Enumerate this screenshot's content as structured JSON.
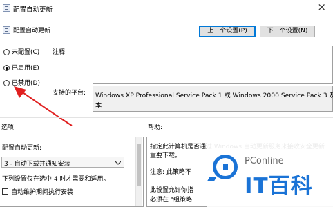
{
  "window": {
    "title": "配置自动更新",
    "close_glyph": "×",
    "setting_name": "配置自动更新",
    "prev_button": "上一个设置(P)",
    "next_button": "下一个设置(N)"
  },
  "state": {
    "options": [
      {
        "label": "未配置(C)",
        "selected": false
      },
      {
        "label": "已启用(E)",
        "selected": true
      },
      {
        "label": "已禁用(D)",
        "selected": false
      }
    ]
  },
  "comment": {
    "label": "注释:",
    "value": ""
  },
  "supported": {
    "label": "支持的平台:",
    "line1": "Windows XP Professional Service Pack 1 或 Windows 2000 Service Pack 3 及",
    "line2": "本"
  },
  "options_panel": {
    "label": "选项:",
    "configure_label": "配置自动更新:",
    "configure_value": "3 - 自动下载并通知安装",
    "note": "下列设置仅在选中 4 时才需要和适用。",
    "maintenance_checkbox": "自动维护期间执行安装",
    "maintenance_checked": false
  },
  "help_panel": {
    "label": "帮助:",
    "line1": "指定此计算机是否通过 Windows 自动更新服务来接收安全更新",
    "line2": "重要下载。",
    "line3": "注意: 此策略不",
    "line4": "此设置允许你指",
    "line5": "必须在 \"组策略"
  },
  "watermark": {
    "brand": "PConline",
    "big_text": "IT百科",
    "color": "#1a73d6"
  },
  "annotation": {
    "arrow_color": "#e02020"
  }
}
